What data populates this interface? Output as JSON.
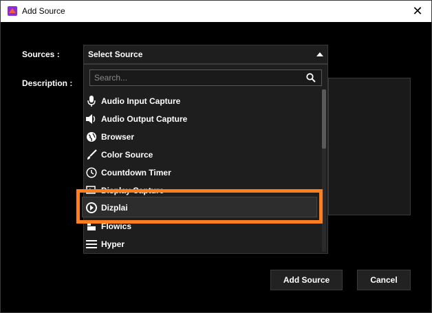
{
  "window": {
    "title": "Add Source",
    "close_symbol": "✕"
  },
  "form": {
    "sources_label": "Sources :",
    "description_label": "Description :",
    "select_value": "Select Source"
  },
  "dropdown": {
    "search_placeholder": "Search...",
    "items": [
      {
        "label": "Audio Input Capture",
        "icon": "microphone-icon"
      },
      {
        "label": "Audio Output Capture",
        "icon": "speaker-icon"
      },
      {
        "label": "Browser",
        "icon": "globe-icon"
      },
      {
        "label": "Color Source",
        "icon": "brush-icon"
      },
      {
        "label": "Countdown Timer",
        "icon": "clock-icon"
      },
      {
        "label": "Display Capture",
        "icon": "display-icon"
      },
      {
        "label": "Dizplai",
        "icon": "dizplai-icon"
      },
      {
        "label": "Flowics",
        "icon": "flowics-icon"
      },
      {
        "label": "Hyper",
        "icon": "hamburger-icon"
      }
    ],
    "highlighted_item": "Dizplai"
  },
  "buttons": {
    "add_source": "Add Source",
    "cancel": "Cancel"
  },
  "colors": {
    "highlight": "#ff7f20",
    "background": "#000000"
  }
}
